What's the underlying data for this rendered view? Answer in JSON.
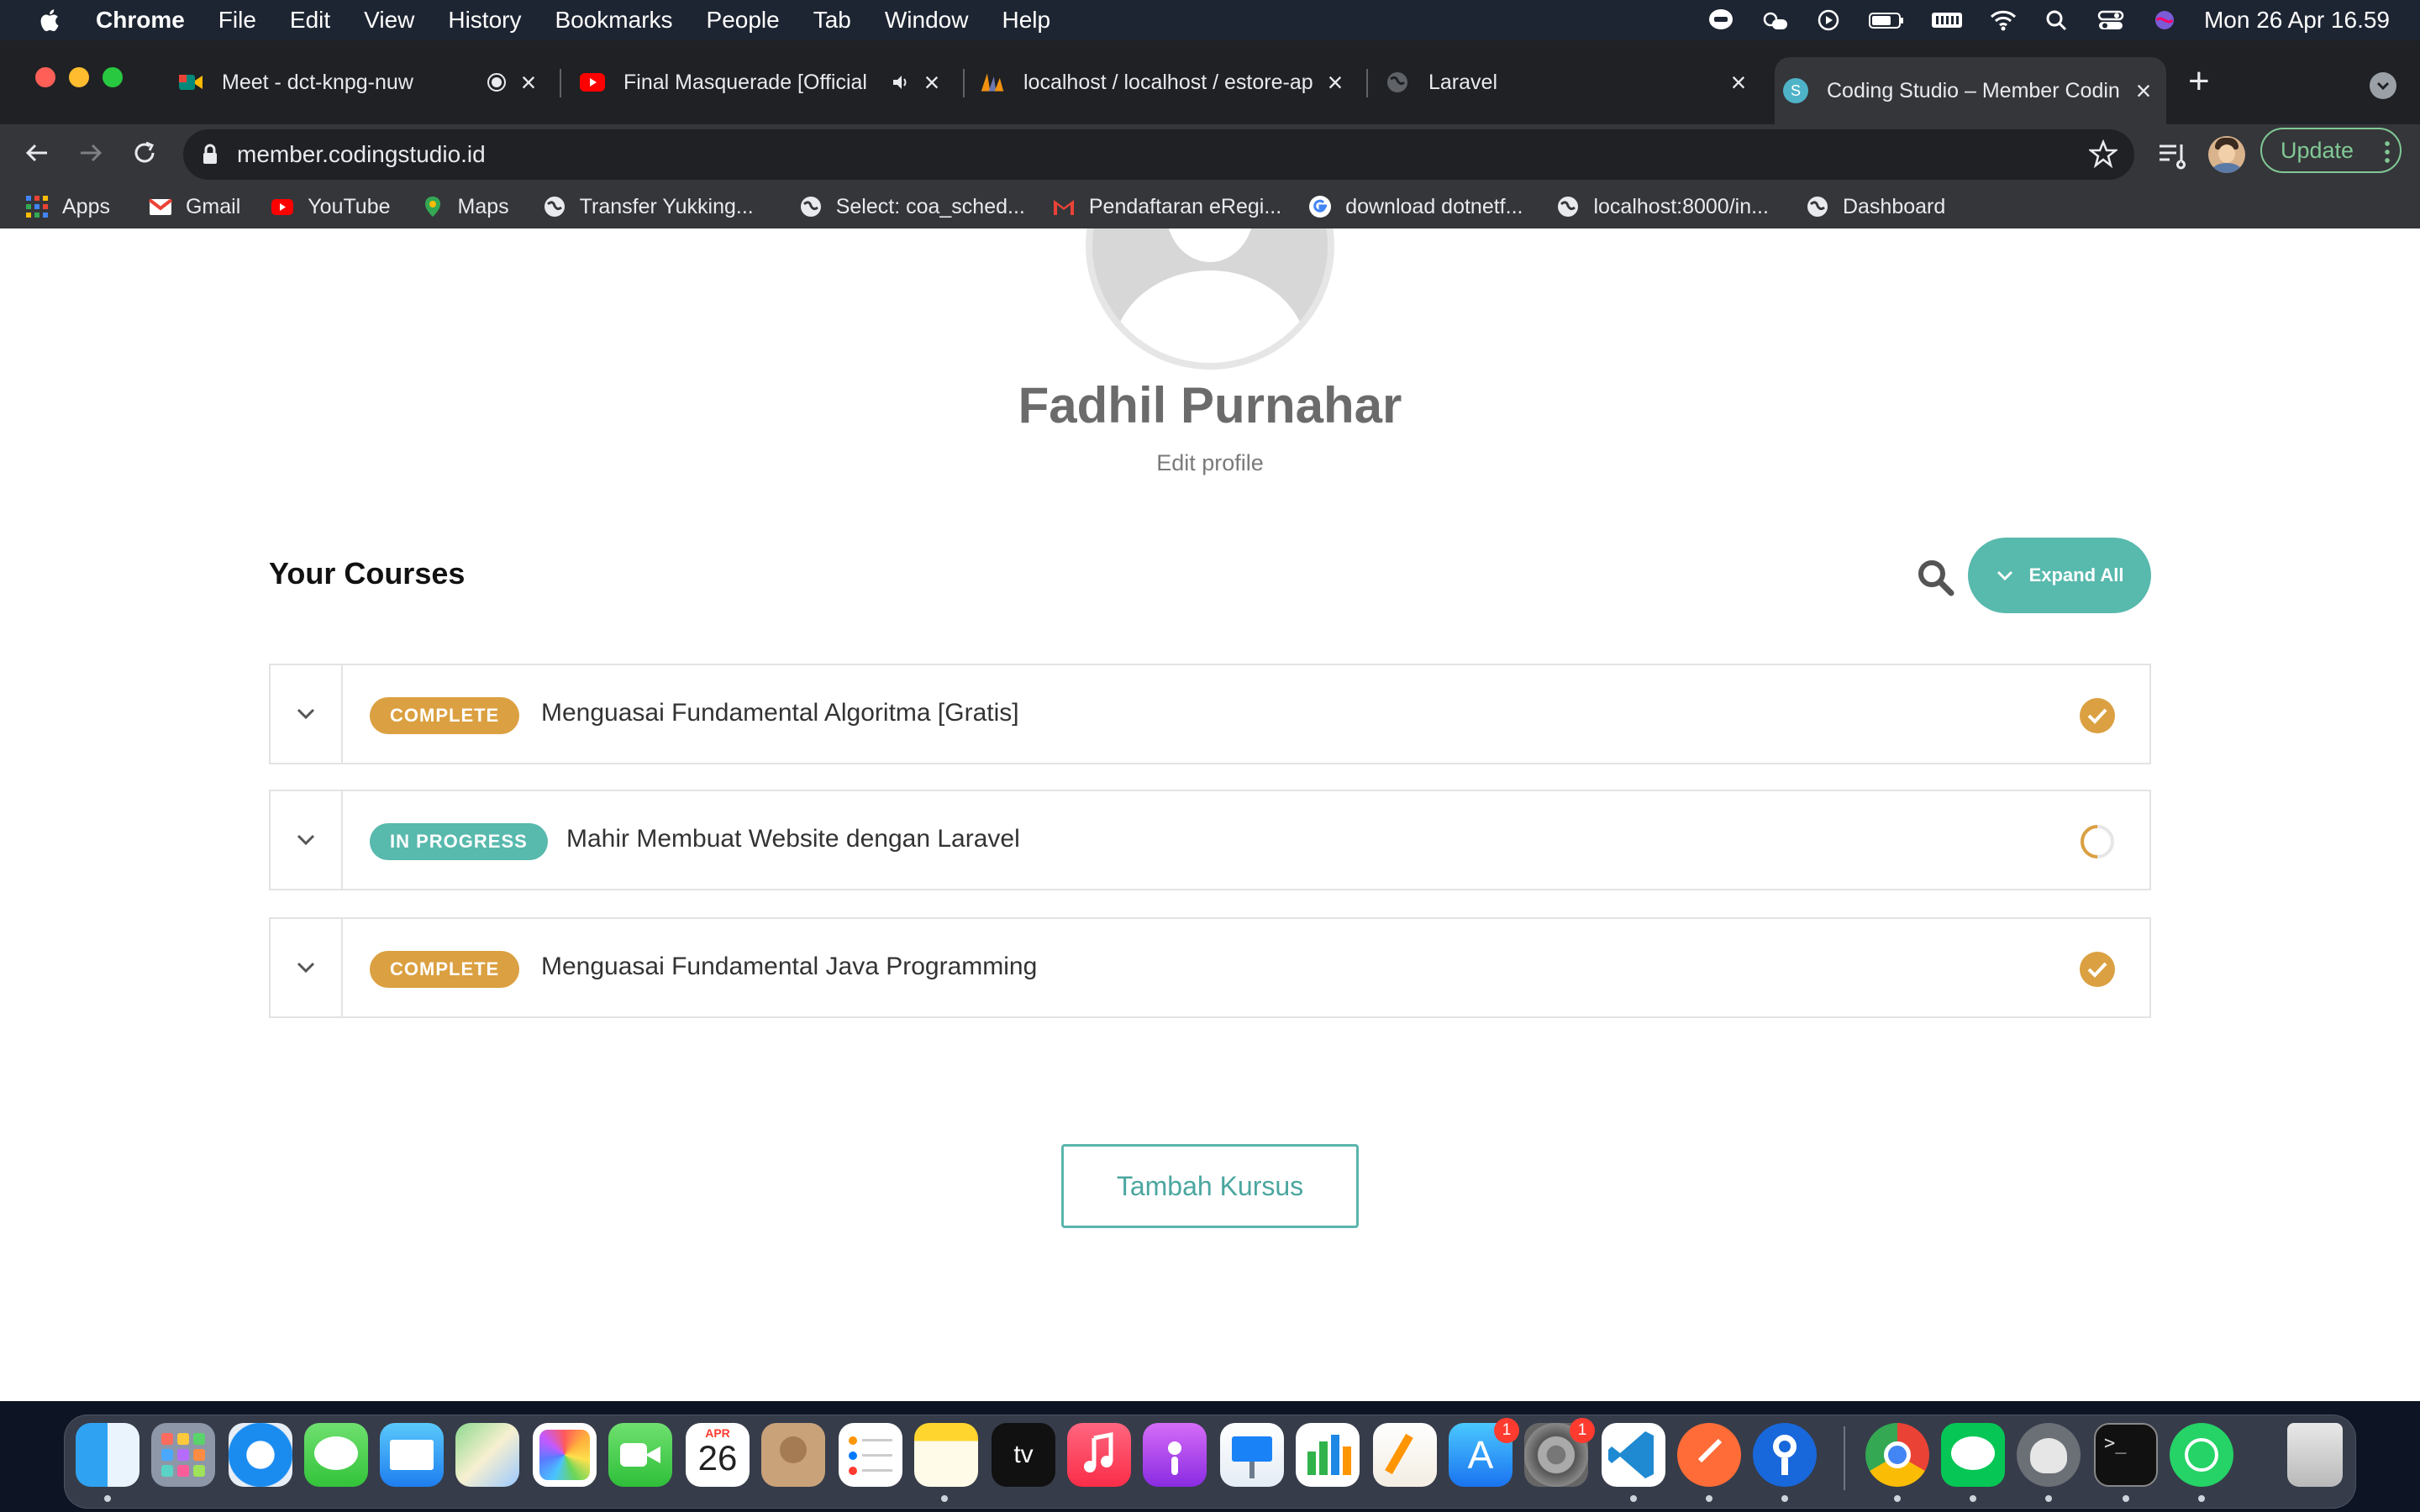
{
  "menubar": {
    "app": "Chrome",
    "items": [
      "File",
      "Edit",
      "View",
      "History",
      "Bookmarks",
      "People",
      "Tab",
      "Window",
      "Help"
    ],
    "clock": "Mon 26 Apr  16.59"
  },
  "tabs": [
    {
      "title": "Meet - dct-knpg-nuw",
      "icon": "google-meet-icon",
      "color": "#00897b"
    },
    {
      "title": "Final Masquerade [Official",
      "icon": "youtube-icon",
      "color": "#ff0000"
    },
    {
      "title": "localhost / localhost / estore-ap",
      "icon": "phpmyadmin-icon",
      "color": "#f29111"
    },
    {
      "title": "Laravel",
      "icon": "globe-icon",
      "color": "#5f6368"
    },
    {
      "title": "Coding Studio – Member Codin",
      "icon": "codingstudio-icon",
      "color": "#4fb3c8"
    }
  ],
  "toolbar": {
    "url": "member.codingstudio.id",
    "update_label": "Update"
  },
  "bookmarks": [
    {
      "label": "Apps",
      "icon": "apps-grid-icon",
      "color": "#4285f4"
    },
    {
      "label": "Gmail",
      "icon": "gmail-icon",
      "color": "#ea4335"
    },
    {
      "label": "YouTube",
      "icon": "youtube-icon",
      "color": "#ff0000"
    },
    {
      "label": "Maps",
      "icon": "maps-pin-icon",
      "color": "#34a853"
    },
    {
      "label": "Transfer Yukking...",
      "icon": "globe-icon",
      "color": "#e8eaed"
    },
    {
      "label": "Select: coa_sched...",
      "icon": "globe-icon",
      "color": "#e8eaed"
    },
    {
      "label": "Pendaftaran eRegi...",
      "icon": "gmail-icon",
      "color": "#ea4335"
    },
    {
      "label": "download dotnetf...",
      "icon": "google-icon",
      "color": "#4285f4"
    },
    {
      "label": "localhost:8000/in...",
      "icon": "globe-icon",
      "color": "#e8eaed"
    },
    {
      "label": "Dashboard",
      "icon": "globe-icon",
      "color": "#e8eaed"
    }
  ],
  "profile": {
    "name": "Fadhil Purnahar",
    "edit_label": "Edit profile"
  },
  "courses_section": {
    "heading": "Your Courses",
    "expand_label": "Expand All",
    "add_label": "Tambah Kursus"
  },
  "courses": [
    {
      "status": "COMPLETE",
      "title": "Menguasai Fundamental Algoritma [Gratis]",
      "badge_color": "#dba041",
      "state": "complete"
    },
    {
      "status": "IN PROGRESS",
      "title": "Mahir Membuat Website dengan Laravel",
      "badge_color": "#58b9ad",
      "state": "in-progress"
    },
    {
      "status": "COMPLETE",
      "title": "Menguasai Fundamental Java Programming",
      "badge_color": "#dba041",
      "state": "complete"
    }
  ],
  "dock": {
    "calendar_month": "APR",
    "calendar_day": "26",
    "appstore_badge": "1",
    "settings_badge": "1"
  }
}
